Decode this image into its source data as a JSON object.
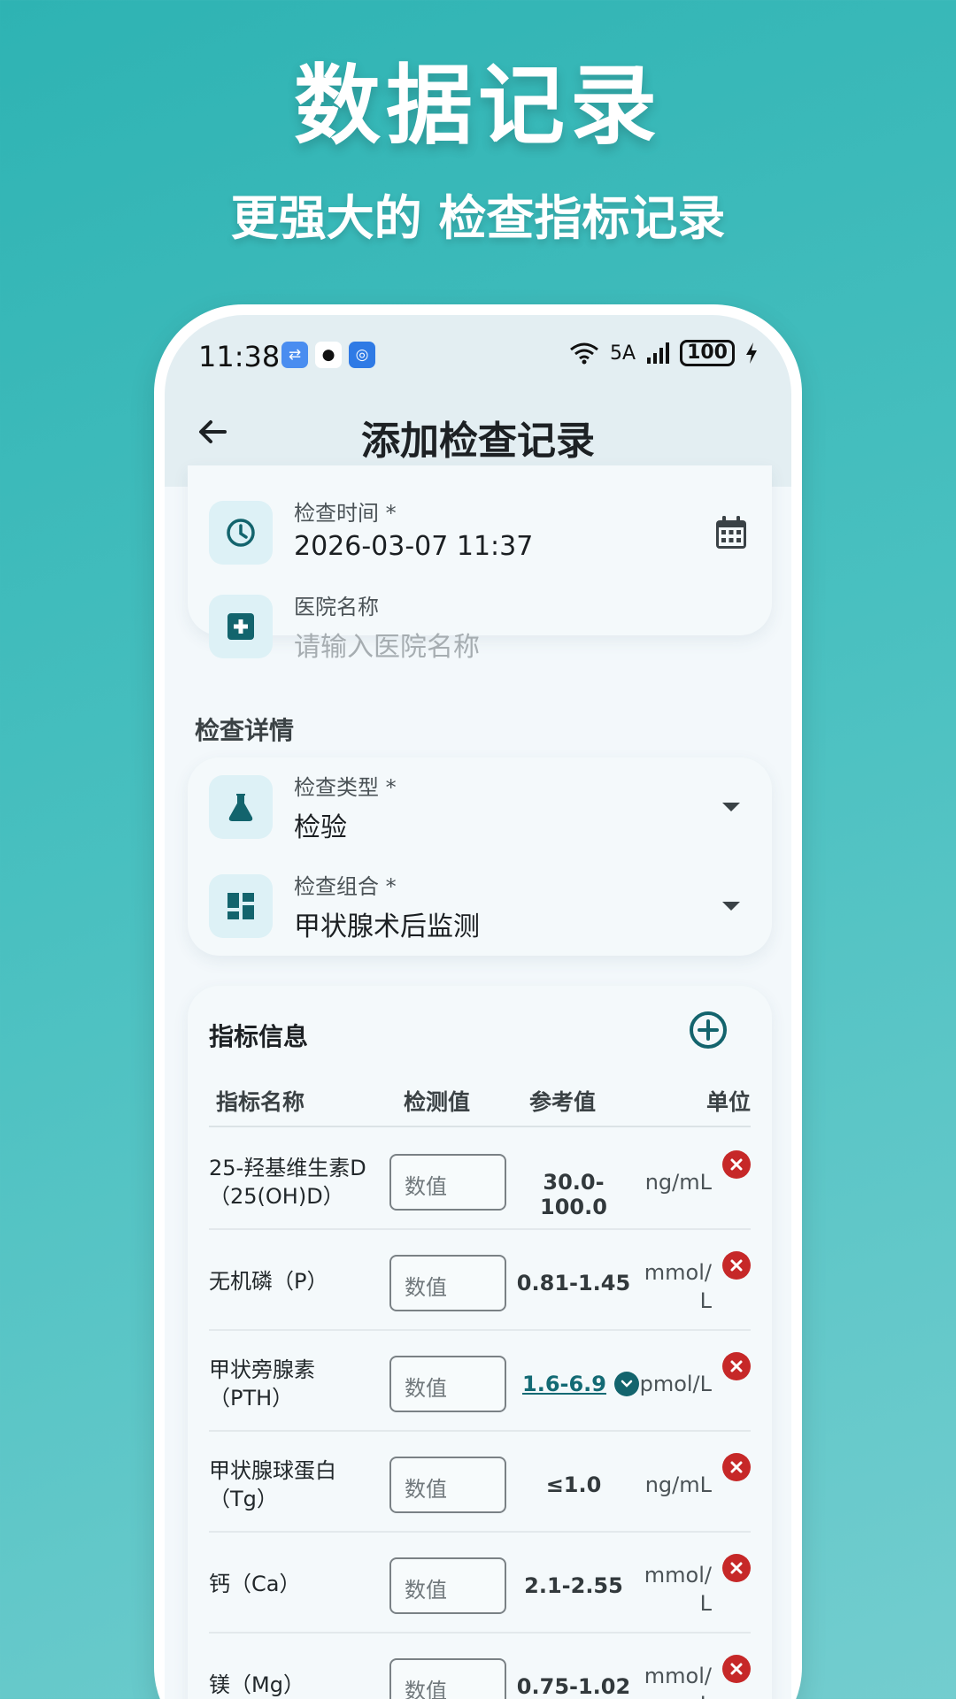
{
  "promo": {
    "title": "数据记录",
    "subtitle": "更强大的 检查指标记录"
  },
  "status_bar": {
    "time": "11:38",
    "network": "5A",
    "battery": "100"
  },
  "header": {
    "title": "添加检查记录"
  },
  "basic_card": {
    "exam_time": {
      "label": "检查时间 *",
      "value": "2026-03-07 11:37"
    },
    "hospital": {
      "label": "医院名称",
      "placeholder": "请输入医院名称"
    }
  },
  "details_section": {
    "title": "检查详情"
  },
  "details_card": {
    "exam_type": {
      "label": "检查类型 *",
      "value": "检验"
    },
    "exam_group": {
      "label": "检查组合 *",
      "value": "甲状腺术后监测"
    }
  },
  "indicators": {
    "title": "指标信息",
    "columns": {
      "name": "指标名称",
      "value": "检测值",
      "reference": "参考值",
      "unit": "单位"
    },
    "input_placeholder": "数值",
    "rows": [
      {
        "name_line1": "25-羟基维生素D",
        "name_line2": "（25(OH)D）",
        "reference": "30.0-100.0",
        "unit_line1": "ng/mL",
        "unit_line2": ""
      },
      {
        "name_line1": "无机磷（P）",
        "name_line2": "",
        "reference": "0.81-1.45",
        "unit_line1": "mmol/",
        "unit_line2": "L"
      },
      {
        "name_line1": "甲状旁腺素",
        "name_line2": "（PTH）",
        "reference": "1.6-6.9",
        "unit_line1": "pmol/L",
        "unit_line2": ""
      },
      {
        "name_line1": "甲状腺球蛋白",
        "name_line2": "（Tg）",
        "reference": "≤1.0",
        "unit_line1": "ng/mL",
        "unit_line2": ""
      },
      {
        "name_line1": "钙（Ca）",
        "name_line2": "",
        "reference": "2.1-2.55",
        "unit_line1": "mmol/",
        "unit_line2": "L"
      },
      {
        "name_line1": "镁（Mg）",
        "name_line2": "",
        "reference": "0.75-1.02",
        "unit_line1": "mmol/",
        "unit_line2": "L"
      }
    ]
  },
  "colors": {
    "accent": "#13646d",
    "delete": "#c62828",
    "background_top": "#2eb3b3"
  }
}
